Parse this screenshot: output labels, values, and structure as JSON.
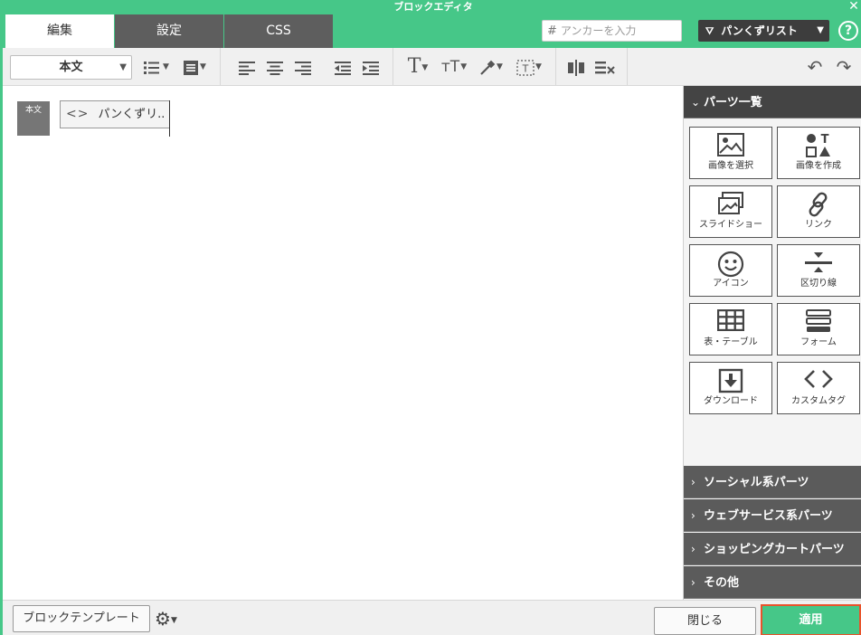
{
  "window": {
    "title": "ブロックエディタ",
    "close_icon": "close-icon"
  },
  "tabs": [
    {
      "label": "編集",
      "active": true
    },
    {
      "label": "設定",
      "active": false
    },
    {
      "label": "CSS",
      "active": false
    }
  ],
  "header": {
    "anchor_prefix": "#",
    "anchor_placeholder": "アンカーを入力",
    "breadcrumb_select": "パンくずリスト",
    "help_label": "?"
  },
  "toolbar": {
    "style_select": "本文",
    "icons": [
      "list-icon",
      "block-format-icon",
      "align-left-icon",
      "align-center-icon",
      "align-right-icon",
      "outdent-icon",
      "indent-icon",
      "text-size-icon",
      "text-height-icon",
      "eyedropper-icon",
      "text-frame-icon",
      "column-split-icon",
      "remove-format-icon",
      "undo-icon",
      "redo-icon"
    ]
  },
  "canvas": {
    "block_label": "本文",
    "block_item": "パンくずリ..",
    "block_item_icon": "code-icon"
  },
  "panel": {
    "main_header": "パーツ一覧",
    "parts": [
      {
        "label": "画像を選択",
        "icon": "image-icon"
      },
      {
        "label": "画像を作成",
        "icon": "shapes-icon"
      },
      {
        "label": "スライドショー",
        "icon": "slideshow-icon"
      },
      {
        "label": "リンク",
        "icon": "link-icon"
      },
      {
        "label": "アイコン",
        "icon": "smiley-icon"
      },
      {
        "label": "区切り線",
        "icon": "divider-icon"
      },
      {
        "label": "表・テーブル",
        "icon": "table-icon"
      },
      {
        "label": "フォーム",
        "icon": "form-icon"
      },
      {
        "label": "ダウンロード",
        "icon": "download-icon"
      },
      {
        "label": "カスタムタグ",
        "icon": "code-icon"
      }
    ],
    "sections": [
      "ソーシャル系パーツ",
      "ウェブサービス系パーツ",
      "ショッピングカートパーツ",
      "その他"
    ]
  },
  "footer": {
    "template_button": "ブロックテンプレート",
    "close_button": "閉じる",
    "apply_button": "適用"
  },
  "colors": {
    "accent": "#46c788",
    "dark": "#5b5b5b",
    "apply_border": "#e8532b"
  }
}
